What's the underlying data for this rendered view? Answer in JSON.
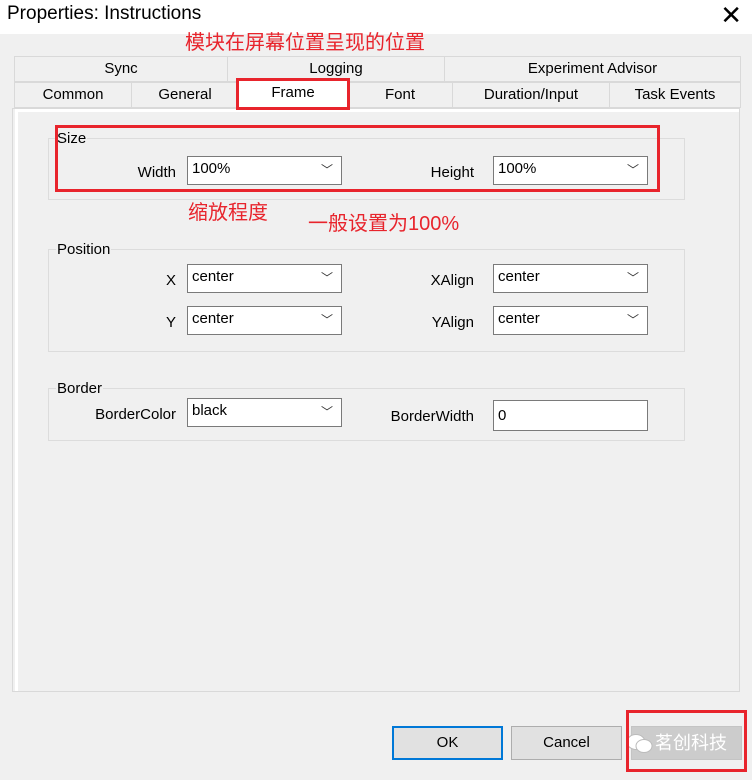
{
  "window": {
    "title": "Properties: Instructions",
    "close": "✕"
  },
  "annotations": {
    "frame_note": "模块在屏幕位置呈现的位置",
    "size_note": "缩放程度",
    "default_note": "一般设置为100%"
  },
  "tabs_row1": [
    "Sync",
    "Logging",
    "Experiment Advisor"
  ],
  "tabs_row2": [
    "Common",
    "General",
    "Frame",
    "Font",
    "Duration/Input",
    "Task Events"
  ],
  "active_tab": "Frame",
  "size": {
    "label": "Size",
    "width_label": "Width",
    "width": "100%",
    "height_label": "Height",
    "height": "100%"
  },
  "position": {
    "label": "Position",
    "x_label": "X",
    "x": "center",
    "xalign_label": "XAlign",
    "xalign": "center",
    "y_label": "Y",
    "y": "center",
    "yalign_label": "YAlign",
    "yalign": "center"
  },
  "border": {
    "label": "Border",
    "color_label": "BorderColor",
    "color": "black",
    "width_label": "BorderWidth",
    "width": "0"
  },
  "buttons": {
    "ok": "OK",
    "cancel": "Cancel"
  },
  "watermark": "茗创科技",
  "colors": {
    "annotation": "#e8242c",
    "focus": "#0078d7"
  }
}
